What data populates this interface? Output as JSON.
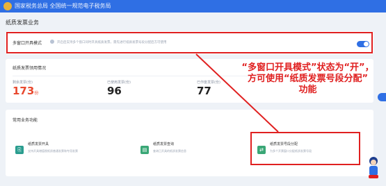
{
  "header": {
    "title": "国家税务总局 全国统一规范电子税务局"
  },
  "page": {
    "title": "纸质发票业务"
  },
  "mode": {
    "label": "多窗口开具模式",
    "description": "开启后支持多个窗口同时开具纸质发票，需先进行纸质发票号段分配后方可使用",
    "toggle_state": "开"
  },
  "stats": {
    "section_title": "纸质发票领用情况",
    "items": [
      {
        "label": "剩余发票(份)",
        "value": "173",
        "unit": "份"
      },
      {
        "label": "已使用发票(份)",
        "value": "96"
      },
      {
        "label": "已作废发票(份)",
        "value": "77"
      }
    ]
  },
  "quick": {
    "section_title": "常用业务功能",
    "items": [
      {
        "title": "纸质发票开具",
        "desc": "支持开具增值税纸质普通发票和专用发票",
        "color": "#2a9d8f",
        "icon": "invoice-issue-icon"
      },
      {
        "title": "纸质发票查询",
        "desc": "查询已开具的纸质发票信息",
        "color": "#3aa776",
        "icon": "invoice-query-icon"
      },
      {
        "title": "纸质发票号段分配",
        "desc": "为多个开票窗口分配纸质发票号段",
        "color": "#3aa776",
        "icon": "segment-allocate-icon"
      }
    ]
  },
  "annotation": {
    "line1": "“多窗口开具模式”状态为“开”，",
    "line2": "方可使用“纸质发票号段分配”",
    "line3": "功能"
  },
  "colors": {
    "brand": "#2f6fe4",
    "highlight": "#e02020",
    "accent_value": "#e8492f"
  }
}
